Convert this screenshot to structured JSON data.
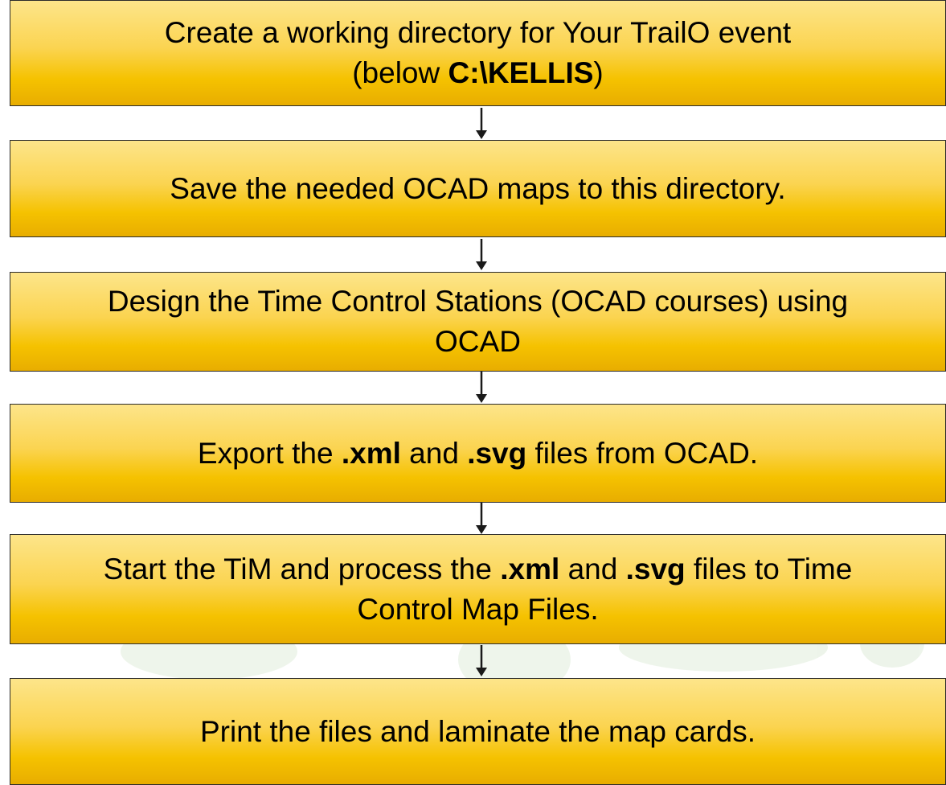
{
  "steps": [
    {
      "id": "create-directory",
      "line1": "Create a working directory for Your TrailO event",
      "line2_prefix": "(below ",
      "line2_bold": "C:\\KELLIS",
      "line2_suffix": ")"
    },
    {
      "id": "save-maps",
      "text": "Save the needed OCAD maps to this directory."
    },
    {
      "id": "design-stations",
      "line1": "Design the Time Control Stations (OCAD courses) using",
      "line2": "OCAD"
    },
    {
      "id": "export-files",
      "prefix": "Export the ",
      "bold1": ".xml",
      "mid": " and ",
      "bold2": ".svg",
      "suffix": " files from OCAD."
    },
    {
      "id": "process-files",
      "prefix": "Start the TiM and process the ",
      "bold1": ".xml",
      "mid": " and ",
      "bold2": ".svg",
      "suffix": " files to Time",
      "line2": "Control Map Files."
    },
    {
      "id": "print-laminate",
      "text": "Print the files and laminate the map cards."
    }
  ],
  "colors": {
    "box_top": "#fde58a",
    "box_bottom": "#e8ad00",
    "border": "#2b2b2b",
    "arrow": "#1a1a1a"
  },
  "icons": {
    "connector": "down-arrow-icon"
  }
}
